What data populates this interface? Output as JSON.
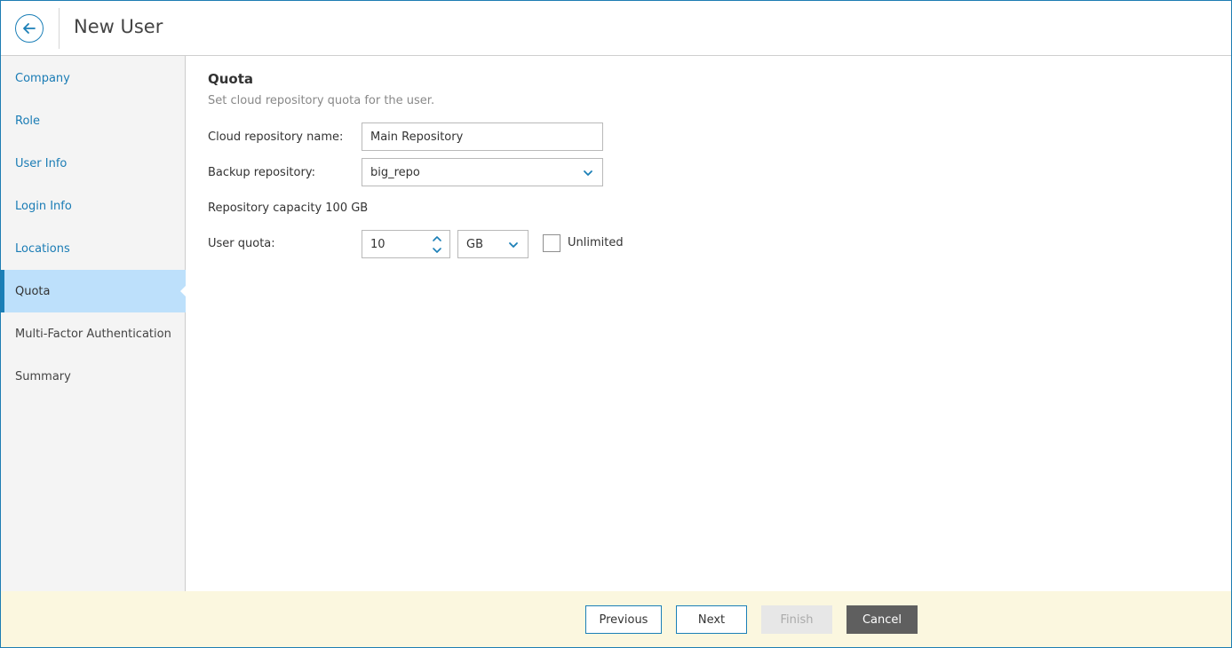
{
  "header": {
    "title": "New User",
    "back_icon": "arrow-left-circle-icon"
  },
  "sidebar": {
    "items": [
      {
        "label": "Company",
        "state": "link"
      },
      {
        "label": "Role",
        "state": "link"
      },
      {
        "label": "User Info",
        "state": "link"
      },
      {
        "label": "Login Info",
        "state": "link"
      },
      {
        "label": "Locations",
        "state": "link"
      },
      {
        "label": "Quota",
        "state": "active"
      },
      {
        "label": "Multi-Factor Authentication",
        "state": "plain"
      },
      {
        "label": "Summary",
        "state": "plain"
      }
    ]
  },
  "main": {
    "section_title": "Quota",
    "section_desc": "Set cloud repository quota for the user.",
    "cloud_repo": {
      "label": "Cloud repository name:",
      "value": "Main Repository"
    },
    "backup_repo": {
      "label": "Backup repository:",
      "value": "big_repo"
    },
    "capacity_text": "Repository capacity 100 GB",
    "user_quota": {
      "label": "User quota:",
      "value": "10",
      "unit": "GB",
      "unlimited_label": "Unlimited",
      "unlimited_checked": false
    }
  },
  "footer": {
    "previous": "Previous",
    "next": "Next",
    "finish": "Finish",
    "cancel": "Cancel"
  },
  "colors": {
    "accent": "#1b7fb7",
    "link": "#1a7cb5",
    "active_bg": "#bde0fb",
    "footer_bg": "#fbf7df",
    "cancel_bg": "#5f5f5f"
  }
}
